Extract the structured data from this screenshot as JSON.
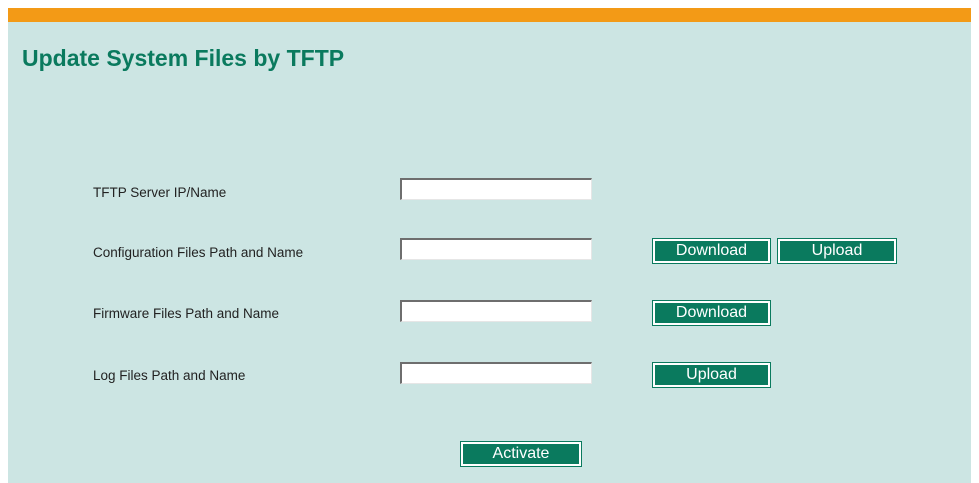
{
  "page": {
    "title": "Update System Files by TFTP"
  },
  "colors": {
    "accent_bar": "#f39a16",
    "panel_bg": "#cce5e3",
    "title": "#0a7a5e",
    "button_bg": "#0a7a5e"
  },
  "form": {
    "server": {
      "label": "TFTP Server IP/Name",
      "value": ""
    },
    "config": {
      "label": "Configuration Files Path and Name",
      "value": "",
      "download_label": "Download",
      "upload_label": "Upload"
    },
    "firmware": {
      "label": "Firmware Files Path and Name",
      "value": "",
      "download_label": "Download"
    },
    "log": {
      "label": "Log Files Path and Name",
      "value": "",
      "upload_label": "Upload"
    },
    "activate_label": "Activate"
  }
}
